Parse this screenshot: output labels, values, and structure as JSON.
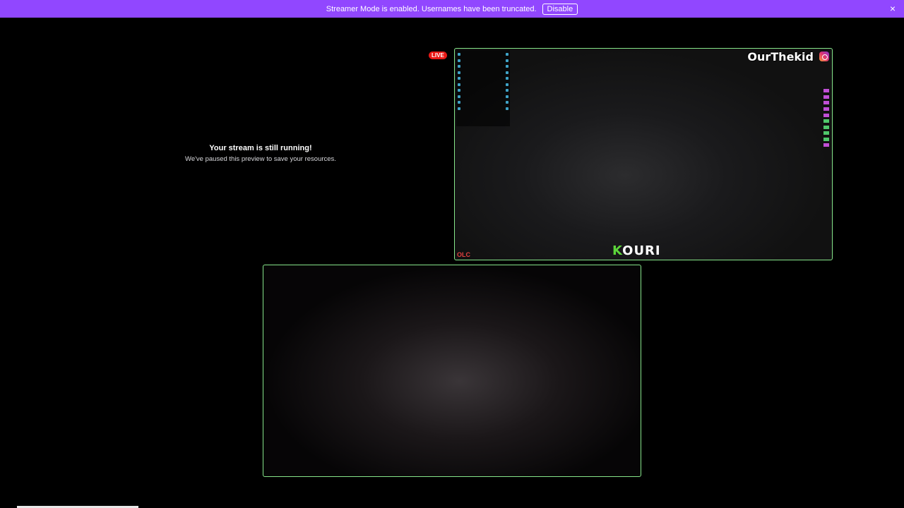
{
  "banner": {
    "message": "Streamer Mode is enabled. Usernames have been truncated.",
    "disable_label": "Disable",
    "close_icon": "×"
  },
  "preview": {
    "title": "Your stream is still running!",
    "subtitle": "We've paused this preview to save your resources."
  },
  "live_label": "LIVE",
  "cam_top": {
    "streamer_name": "OurThekid",
    "logo_k": "K",
    "logo_rest": "OURI",
    "corner_tag": "OLC"
  }
}
